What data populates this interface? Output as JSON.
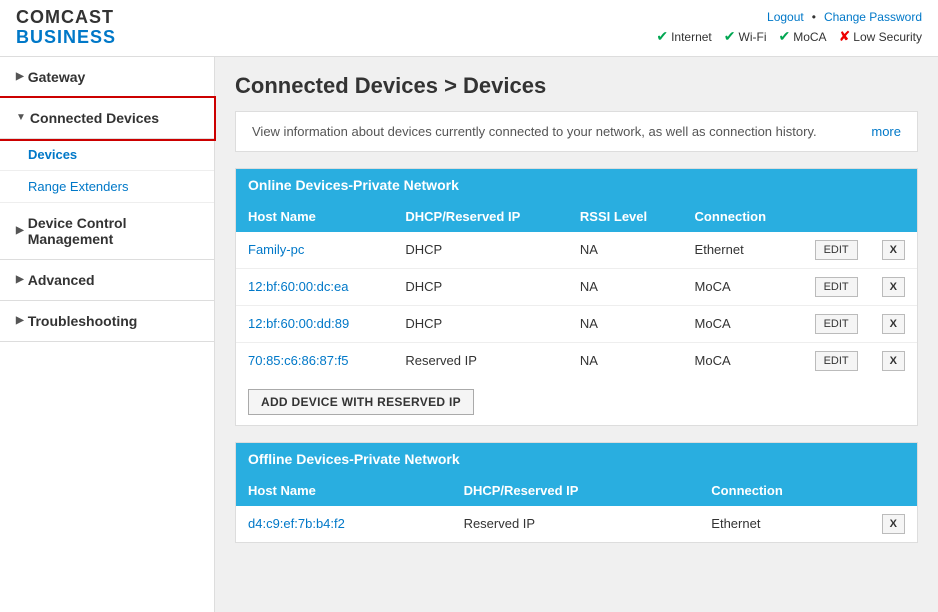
{
  "header": {
    "logo_comcast": "COMCAST",
    "logo_business": "BUSINESS",
    "links": {
      "logout": "Logout",
      "separator": "•",
      "change_password": "Change Password"
    },
    "status": [
      {
        "label": "Internet",
        "state": "ok"
      },
      {
        "label": "Wi-Fi",
        "state": "ok"
      },
      {
        "label": "MoCA",
        "state": "ok"
      },
      {
        "label": "Low Security",
        "state": "err"
      }
    ]
  },
  "sidebar": {
    "items": [
      {
        "id": "gateway",
        "label": "Gateway",
        "arrow": "▶",
        "active": false
      },
      {
        "id": "connected-devices",
        "label": "Connected Devices",
        "arrow": "▼",
        "active": true
      },
      {
        "id": "device-control",
        "label": "Device Control Management",
        "arrow": "▶",
        "active": false
      },
      {
        "id": "advanced",
        "label": "Advanced",
        "arrow": "▶",
        "active": false
      },
      {
        "id": "troubleshooting",
        "label": "Troubleshooting",
        "arrow": "▶",
        "active": false
      }
    ],
    "sub_items": [
      {
        "id": "devices",
        "label": "Devices",
        "active": true
      },
      {
        "id": "range-extenders",
        "label": "Range Extenders",
        "active": false
      }
    ]
  },
  "content": {
    "page_title": "Connected Devices > Devices",
    "info_text": "View information about devices currently connected to your network, as well as connection history.",
    "more_link": "more",
    "online_section": {
      "title": "Online Devices-Private Network",
      "columns": [
        "Host Name",
        "DHCP/Reserved IP",
        "RSSI Level",
        "Connection",
        "",
        ""
      ],
      "rows": [
        {
          "host": "Family-pc",
          "dhcp": "DHCP",
          "rssi": "NA",
          "connection": "Ethernet"
        },
        {
          "host": "12:bf:60:00:dc:ea",
          "dhcp": "DHCP",
          "rssi": "NA",
          "connection": "MoCA"
        },
        {
          "host": "12:bf:60:00:dd:89",
          "dhcp": "DHCP",
          "rssi": "NA",
          "connection": "MoCA"
        },
        {
          "host": "70:85:c6:86:87:f5",
          "dhcp": "Reserved IP",
          "rssi": "NA",
          "connection": "MoCA"
        }
      ],
      "add_button": "ADD DEVICE WITH RESERVED IP"
    },
    "offline_section": {
      "title": "Offline Devices-Private Network",
      "columns": [
        "Host Name",
        "DHCP/Reserved IP",
        "Connection",
        ""
      ],
      "rows": [
        {
          "host": "d4:c9:ef:7b:b4:f2",
          "dhcp": "Reserved IP",
          "connection": "Ethernet"
        }
      ]
    }
  }
}
